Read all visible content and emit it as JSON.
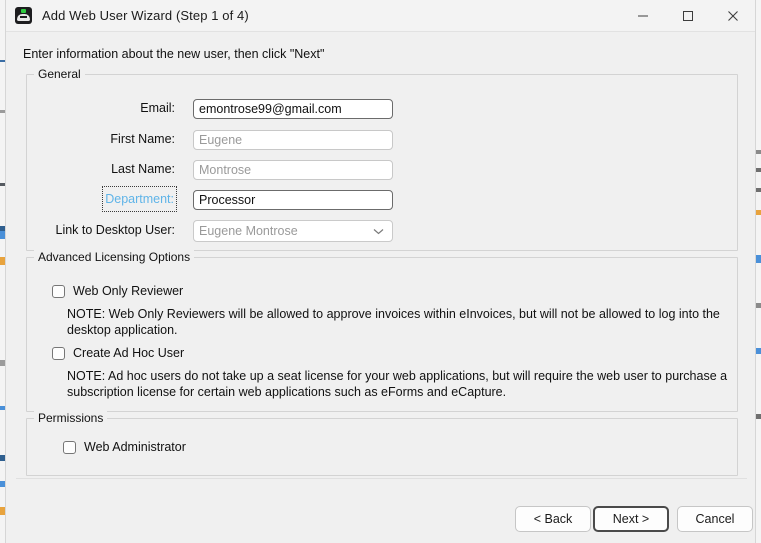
{
  "window": {
    "title": "Add Web User Wizard (Step 1 of 4)",
    "icon": "app-icon",
    "controls": {
      "minimize": "minimize-icon",
      "maximize": "maximize-icon",
      "close": "close-icon"
    }
  },
  "instruction": "Enter information about the new user, then click \"Next\"",
  "general": {
    "legend": "General",
    "fields": [
      {
        "label": "Email:",
        "value": "emontrose99@gmail.com",
        "placeholder": "",
        "state": "filled",
        "type": "text"
      },
      {
        "label": "First Name:",
        "value": "Eugene",
        "placeholder": "Eugene",
        "state": "ghost",
        "type": "text"
      },
      {
        "label": "Last Name:",
        "value": "Montrose",
        "placeholder": "Montrose",
        "state": "ghost",
        "type": "text"
      },
      {
        "label": "Department:",
        "value": "Processor",
        "placeholder": "",
        "state": "filled",
        "type": "text",
        "label_is_link": true
      },
      {
        "label": "Link to Desktop User:",
        "value": "Eugene  Montrose",
        "placeholder": "Eugene  Montrose",
        "state": "ghost",
        "type": "combo"
      }
    ]
  },
  "advanced": {
    "legend": "Advanced Licensing Options",
    "options": [
      {
        "label": "Web Only Reviewer",
        "checked": false,
        "note": "NOTE: Web Only Reviewers will be allowed to approve invoices within eInvoices, but will not be allowed to log into the desktop application."
      },
      {
        "label": "Create Ad Hoc User",
        "checked": false,
        "note": "NOTE: Ad hoc users do not take up a seat license for your web applications, but will require the web user to purchase a subscription license for certain web applications such as eForms and eCapture."
      }
    ]
  },
  "permissions": {
    "legend": "Permissions",
    "options": [
      {
        "label": "Web Administrator",
        "checked": false
      }
    ]
  },
  "buttons": {
    "back": "< Back",
    "next": "Next >",
    "cancel": "Cancel"
  },
  "colors": {
    "dialog_bg": "#f0f0f0",
    "titlebar_bg": "#f3f3f3",
    "link": "#5fb4e8",
    "ghost_text": "#9a9a9a",
    "border": "#d3d3d3"
  }
}
